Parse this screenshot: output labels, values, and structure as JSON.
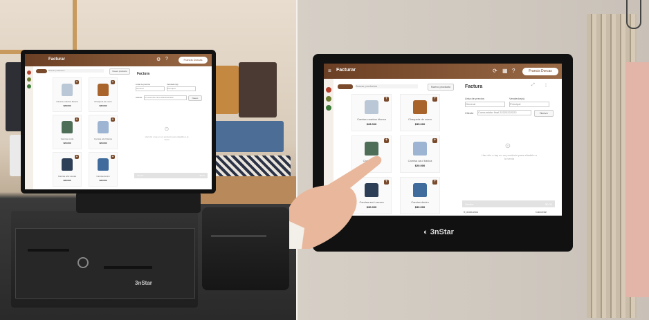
{
  "pos_app": {
    "app_title": "Facturar",
    "user_pill": "Francis Dorcas",
    "search_placeholder": "Buscar productos",
    "catalog_button": "Nuevo producto",
    "panel_title": "Factura",
    "field_list_label": "Lista de precios",
    "field_list_value": "General",
    "field_seller_label": "Vendedor(a)",
    "field_seller_value": "Principal",
    "client_label": "Cliente",
    "client_value": "Consumidor final 22222222222",
    "client_button": "Nuevo",
    "empty_message": "Haz clic o tap en un producto para añadirlo a la venta",
    "total_label": "Vender",
    "total_value": "$0.00",
    "footer_left": "0 productos",
    "footer_right": "Cancelar",
    "products": [
      {
        "code": "Code",
        "name": "Camisa cuadros blanca",
        "price": "$28.000"
      },
      {
        "code": "Code",
        "name": "Chaqueta de cuero",
        "price": "$35.000"
      },
      {
        "code": "Code",
        "name": "Camisa verde",
        "price": "$20.000"
      },
      {
        "code": "Code",
        "name": "Camisa azul básica",
        "price": "$20.000"
      },
      {
        "code": "Code",
        "name": "Camisa azul oscura",
        "price": "$30.000"
      },
      {
        "code": "Code",
        "name": "Camisa denim",
        "price": "$30.000"
      }
    ]
  },
  "brand": {
    "logo_text": "3nStar"
  },
  "colors": {
    "accent": "#7a4a2c",
    "topbar_from": "#6b3f24",
    "topbar_to": "#9a6a46"
  }
}
